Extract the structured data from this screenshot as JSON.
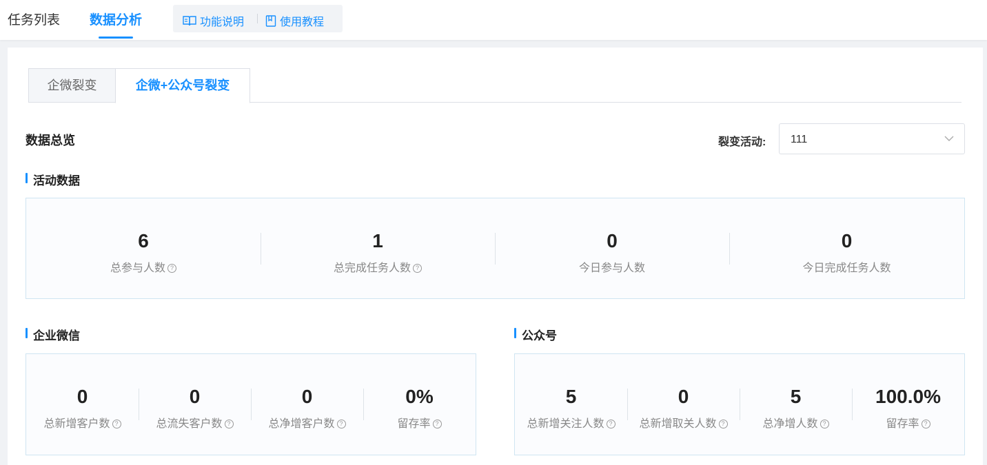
{
  "topnav": {
    "tabs": [
      {
        "label": "任务列表",
        "active": false
      },
      {
        "label": "数据分析",
        "active": true
      }
    ],
    "help": {
      "feature_label": "功能说明",
      "feature_icon": "book-open-icon",
      "tutorial_label": "使用教程",
      "tutorial_icon": "document-icon"
    }
  },
  "subtabs": [
    {
      "label": "企微裂变",
      "active": false
    },
    {
      "label": "企微+公众号裂变",
      "active": true
    }
  ],
  "overview": {
    "title": "数据总览",
    "activity_label": "裂变活动:",
    "activity_value": "111"
  },
  "activity_data": {
    "title": "活动数据",
    "stats": [
      {
        "value": "6",
        "label": "总参与人数",
        "help": true
      },
      {
        "value": "1",
        "label": "总完成任务人数",
        "help": true
      },
      {
        "value": "0",
        "label": "今日参与人数",
        "help": false
      },
      {
        "value": "0",
        "label": "今日完成任务人数",
        "help": false
      }
    ]
  },
  "wecom": {
    "title": "企业微信",
    "stats": [
      {
        "value": "0",
        "label": "总新增客户数",
        "help": true
      },
      {
        "value": "0",
        "label": "总流失客户数",
        "help": true
      },
      {
        "value": "0",
        "label": "总净增客户数",
        "help": true
      },
      {
        "value": "0%",
        "label": "留存率",
        "help": true
      }
    ]
  },
  "official": {
    "title": "公众号",
    "stats": [
      {
        "value": "5",
        "label": "总新增关注人数",
        "help": true
      },
      {
        "value": "0",
        "label": "总新增取关人数",
        "help": true
      },
      {
        "value": "5",
        "label": "总净增人数",
        "help": true
      },
      {
        "value": "100.0%",
        "label": "留存率",
        "help": true
      }
    ]
  },
  "colors": {
    "accent": "#1890ff",
    "box_border": "#cfe5f2"
  }
}
